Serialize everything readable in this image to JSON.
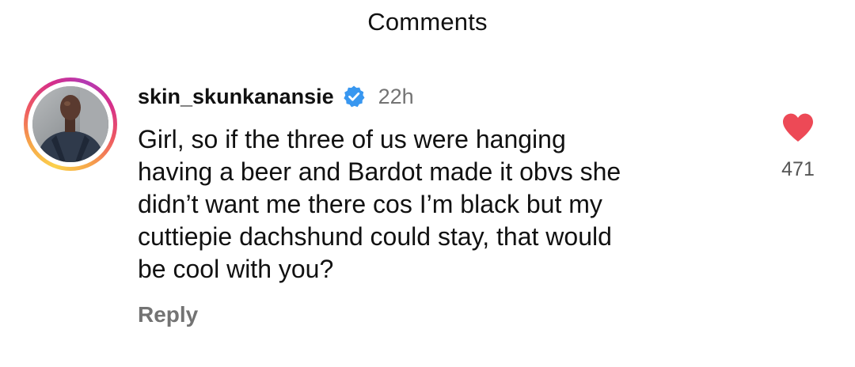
{
  "header": {
    "title": "Comments"
  },
  "comment": {
    "username": "skin_skunkanansie",
    "verified": true,
    "time": "22h",
    "text": "Girl, so if the three of us were hanging\nhaving a beer and Bardot made it obvs she\ndidn’t want me there cos I’m black but my\ncuttiepie dachshund could stay, that would\nbe cool with you?",
    "reply_label": "Reply",
    "like_count": "471",
    "liked": true,
    "icons": {
      "avatar": "profile-photo",
      "verified": "verified-badge-icon",
      "like": "heart-icon"
    }
  },
  "colors": {
    "like": "#ed4956",
    "verified": "#3897f0",
    "secondary_text": "#737373"
  }
}
